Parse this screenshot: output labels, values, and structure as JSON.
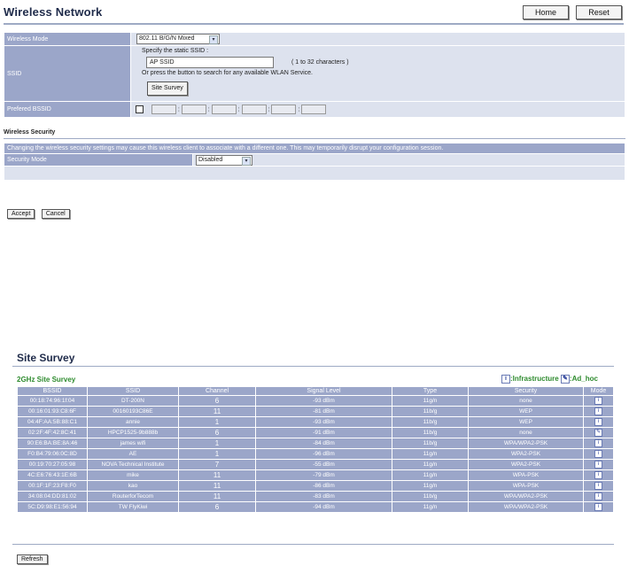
{
  "header": {
    "title": "Wireless Network",
    "home_label": "Home",
    "reset_label": "Reset"
  },
  "form": {
    "wireless_mode_label": "Wireless Mode",
    "wireless_mode_value": "802.11 B/G/N Mixed",
    "ssid_label": "SSID",
    "ssid_instruction": "Specify the static SSID  :",
    "ssid_value": "AP SSID",
    "ssid_hint": "( 1 to 32 characters )",
    "ssid_or_text": "Or press the button to search for any available WLAN Service.",
    "site_survey_button": "Site Survey",
    "preferred_bssid_label": "Prefered BSSID",
    "mac_separator": ":"
  },
  "security": {
    "section_title": "Wireless Security",
    "warning": "Changing the wireless security settings may cause this wireless client to associate with a different one. This may temporarily disrupt your configuration session.",
    "mode_label": "Security Mode",
    "mode_value": "Disabled"
  },
  "actions": {
    "accept_label": "Accept",
    "cancel_label": "Cancel"
  },
  "survey": {
    "title": "Site Survey",
    "subtitle": "2GHz Site Survey",
    "legend_infra": ":Infrastructure",
    "legend_adhoc": ":Ad_hoc",
    "columns": [
      "BSSID",
      "SSID",
      "Channel",
      "Signal Level",
      "Type",
      "Security",
      "Mode"
    ],
    "rows": [
      {
        "bssid": "00:18:74:96:1f:04",
        "ssid": "DT-200N",
        "channel": "6",
        "signal": "-93 dBm",
        "type": "11g/n",
        "security": "none",
        "mode": "infrastructure"
      },
      {
        "bssid": "00:16:01:93:C8:6F",
        "ssid": "00160193C86E",
        "channel": "11",
        "signal": "-81 dBm",
        "type": "11b/g",
        "security": "WEP",
        "mode": "infrastructure"
      },
      {
        "bssid": "04:4F:AA:5B:88:C1",
        "ssid": "annie",
        "channel": "1",
        "signal": "-93 dBm",
        "type": "11b/g",
        "security": "WEP",
        "mode": "infrastructure"
      },
      {
        "bssid": "02:2F:4F:42:8C:41",
        "ssid": "HPCP1525-9b888b",
        "channel": "6",
        "signal": "-91 dBm",
        "type": "11b/g",
        "security": "none",
        "mode": "adhoc"
      },
      {
        "bssid": "90:E6:BA:BE:8A:46",
        "ssid": "james wifi",
        "channel": "1",
        "signal": "-84 dBm",
        "type": "11b/g",
        "security": "WPA/WPA2-PSK",
        "mode": "infrastructure"
      },
      {
        "bssid": "F0:B4:79:06:0C:8D",
        "ssid": "AE",
        "channel": "1",
        "signal": "-96 dBm",
        "type": "11g/n",
        "security": "WPA2-PSK",
        "mode": "infrastructure"
      },
      {
        "bssid": "00:19:70:27:05:98",
        "ssid": "NOVA Technical Institute",
        "channel": "7",
        "signal": "-55 dBm",
        "type": "11g/n",
        "security": "WPA2-PSK",
        "mode": "infrastructure"
      },
      {
        "bssid": "4C:E6:76:43:1E:6B",
        "ssid": "mike",
        "channel": "11",
        "signal": "-79 dBm",
        "type": "11g/n",
        "security": "WPA-PSK",
        "mode": "infrastructure"
      },
      {
        "bssid": "00:1F:1F:23:F8:F0",
        "ssid": "kao",
        "channel": "11",
        "signal": "-86 dBm",
        "type": "11g/n",
        "security": "WPA-PSK",
        "mode": "infrastructure"
      },
      {
        "bssid": "34:08:04:DD:81:02",
        "ssid": "RouterforTecom",
        "channel": "11",
        "signal": "-83 dBm",
        "type": "11b/g",
        "security": "WPA/WPA2-PSK",
        "mode": "infrastructure"
      },
      {
        "bssid": "5C:D9:98:E1:56:94",
        "ssid": "TW FlyKiwi",
        "channel": "6",
        "signal": "-94 dBm",
        "type": "11g/n",
        "security": "WPA/WPA2-PSK",
        "mode": "infrastructure"
      }
    ],
    "refresh_label": "Refresh"
  }
}
